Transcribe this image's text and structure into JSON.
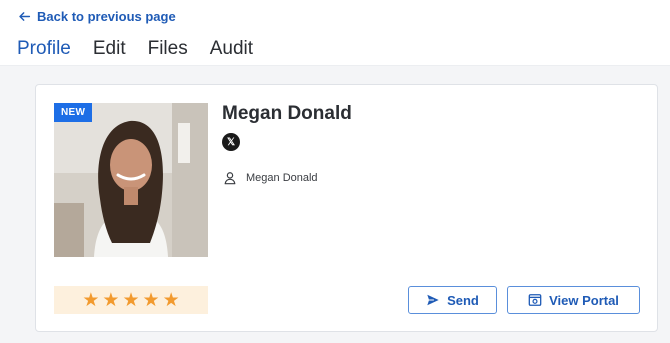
{
  "nav": {
    "back_label": "Back to previous page"
  },
  "tabs": [
    {
      "label": "Profile",
      "active": true
    },
    {
      "label": "Edit",
      "active": false
    },
    {
      "label": "Files",
      "active": false
    },
    {
      "label": "Audit",
      "active": false
    }
  ],
  "profile": {
    "badge": "NEW",
    "name": "Megan Donald",
    "social_icon": "x-logo-icon",
    "owner_label": "Megan Donald",
    "rating": 5,
    "rating_max": 5
  },
  "actions": {
    "send_label": "Send",
    "portal_label": "View Portal"
  },
  "colors": {
    "accent": "#1f5bb6",
    "badge": "#1d6ee6",
    "star": "#f29a2e",
    "rating_bg": "#fdf0dd"
  }
}
